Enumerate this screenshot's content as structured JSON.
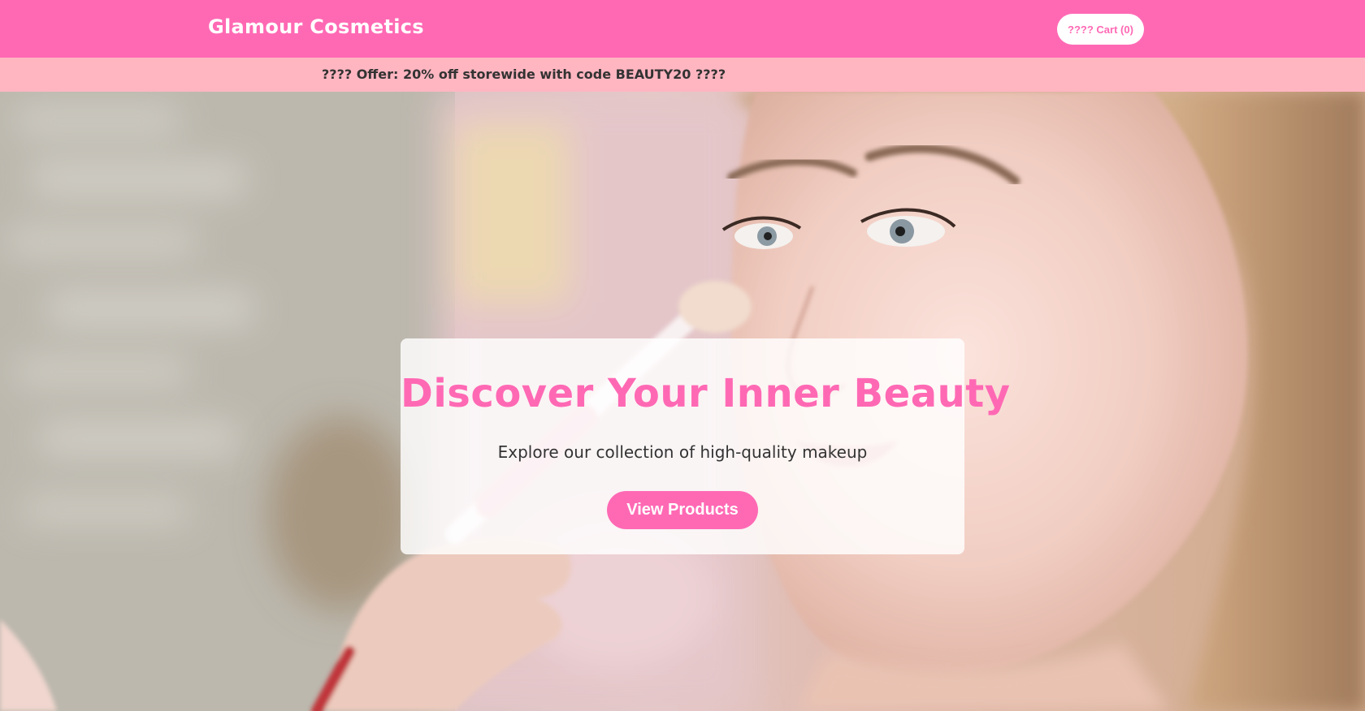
{
  "header": {
    "brand": "Glamour Cosmetics",
    "cart_label": "???? Cart (0)"
  },
  "promo": {
    "text": "???? Offer: 20% off storewide with code BEAUTY20 ????"
  },
  "hero": {
    "title": "Discover Your Inner Beauty",
    "subtitle": "Explore our collection of high-quality makeup",
    "cta_label": "View Products"
  },
  "colors": {
    "brand_pink": "#ff69b4",
    "promo_pink": "#ffb6c1",
    "text_dark": "#333333"
  }
}
